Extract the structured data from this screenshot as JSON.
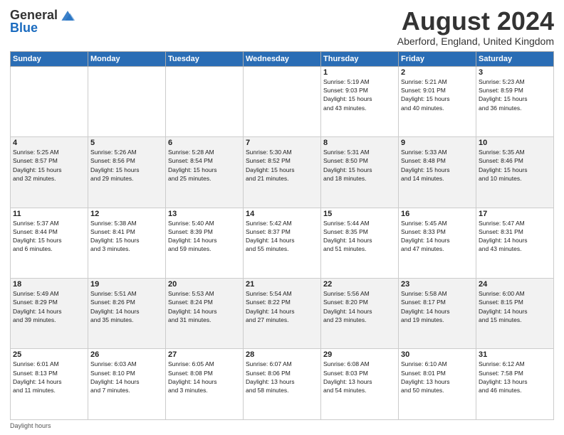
{
  "logo": {
    "general": "General",
    "blue": "Blue"
  },
  "header": {
    "month_year": "August 2024",
    "location": "Aberford, England, United Kingdom"
  },
  "days_of_week": [
    "Sunday",
    "Monday",
    "Tuesday",
    "Wednesday",
    "Thursday",
    "Friday",
    "Saturday"
  ],
  "weeks": [
    [
      {
        "day": "",
        "info": ""
      },
      {
        "day": "",
        "info": ""
      },
      {
        "day": "",
        "info": ""
      },
      {
        "day": "",
        "info": ""
      },
      {
        "day": "1",
        "info": "Sunrise: 5:19 AM\nSunset: 9:03 PM\nDaylight: 15 hours\nand 43 minutes."
      },
      {
        "day": "2",
        "info": "Sunrise: 5:21 AM\nSunset: 9:01 PM\nDaylight: 15 hours\nand 40 minutes."
      },
      {
        "day": "3",
        "info": "Sunrise: 5:23 AM\nSunset: 8:59 PM\nDaylight: 15 hours\nand 36 minutes."
      }
    ],
    [
      {
        "day": "4",
        "info": "Sunrise: 5:25 AM\nSunset: 8:57 PM\nDaylight: 15 hours\nand 32 minutes."
      },
      {
        "day": "5",
        "info": "Sunrise: 5:26 AM\nSunset: 8:56 PM\nDaylight: 15 hours\nand 29 minutes."
      },
      {
        "day": "6",
        "info": "Sunrise: 5:28 AM\nSunset: 8:54 PM\nDaylight: 15 hours\nand 25 minutes."
      },
      {
        "day": "7",
        "info": "Sunrise: 5:30 AM\nSunset: 8:52 PM\nDaylight: 15 hours\nand 21 minutes."
      },
      {
        "day": "8",
        "info": "Sunrise: 5:31 AM\nSunset: 8:50 PM\nDaylight: 15 hours\nand 18 minutes."
      },
      {
        "day": "9",
        "info": "Sunrise: 5:33 AM\nSunset: 8:48 PM\nDaylight: 15 hours\nand 14 minutes."
      },
      {
        "day": "10",
        "info": "Sunrise: 5:35 AM\nSunset: 8:46 PM\nDaylight: 15 hours\nand 10 minutes."
      }
    ],
    [
      {
        "day": "11",
        "info": "Sunrise: 5:37 AM\nSunset: 8:44 PM\nDaylight: 15 hours\nand 6 minutes."
      },
      {
        "day": "12",
        "info": "Sunrise: 5:38 AM\nSunset: 8:41 PM\nDaylight: 15 hours\nand 3 minutes."
      },
      {
        "day": "13",
        "info": "Sunrise: 5:40 AM\nSunset: 8:39 PM\nDaylight: 14 hours\nand 59 minutes."
      },
      {
        "day": "14",
        "info": "Sunrise: 5:42 AM\nSunset: 8:37 PM\nDaylight: 14 hours\nand 55 minutes."
      },
      {
        "day": "15",
        "info": "Sunrise: 5:44 AM\nSunset: 8:35 PM\nDaylight: 14 hours\nand 51 minutes."
      },
      {
        "day": "16",
        "info": "Sunrise: 5:45 AM\nSunset: 8:33 PM\nDaylight: 14 hours\nand 47 minutes."
      },
      {
        "day": "17",
        "info": "Sunrise: 5:47 AM\nSunset: 8:31 PM\nDaylight: 14 hours\nand 43 minutes."
      }
    ],
    [
      {
        "day": "18",
        "info": "Sunrise: 5:49 AM\nSunset: 8:29 PM\nDaylight: 14 hours\nand 39 minutes."
      },
      {
        "day": "19",
        "info": "Sunrise: 5:51 AM\nSunset: 8:26 PM\nDaylight: 14 hours\nand 35 minutes."
      },
      {
        "day": "20",
        "info": "Sunrise: 5:53 AM\nSunset: 8:24 PM\nDaylight: 14 hours\nand 31 minutes."
      },
      {
        "day": "21",
        "info": "Sunrise: 5:54 AM\nSunset: 8:22 PM\nDaylight: 14 hours\nand 27 minutes."
      },
      {
        "day": "22",
        "info": "Sunrise: 5:56 AM\nSunset: 8:20 PM\nDaylight: 14 hours\nand 23 minutes."
      },
      {
        "day": "23",
        "info": "Sunrise: 5:58 AM\nSunset: 8:17 PM\nDaylight: 14 hours\nand 19 minutes."
      },
      {
        "day": "24",
        "info": "Sunrise: 6:00 AM\nSunset: 8:15 PM\nDaylight: 14 hours\nand 15 minutes."
      }
    ],
    [
      {
        "day": "25",
        "info": "Sunrise: 6:01 AM\nSunset: 8:13 PM\nDaylight: 14 hours\nand 11 minutes."
      },
      {
        "day": "26",
        "info": "Sunrise: 6:03 AM\nSunset: 8:10 PM\nDaylight: 14 hours\nand 7 minutes."
      },
      {
        "day": "27",
        "info": "Sunrise: 6:05 AM\nSunset: 8:08 PM\nDaylight: 14 hours\nand 3 minutes."
      },
      {
        "day": "28",
        "info": "Sunrise: 6:07 AM\nSunset: 8:06 PM\nDaylight: 13 hours\nand 58 minutes."
      },
      {
        "day": "29",
        "info": "Sunrise: 6:08 AM\nSunset: 8:03 PM\nDaylight: 13 hours\nand 54 minutes."
      },
      {
        "day": "30",
        "info": "Sunrise: 6:10 AM\nSunset: 8:01 PM\nDaylight: 13 hours\nand 50 minutes."
      },
      {
        "day": "31",
        "info": "Sunrise: 6:12 AM\nSunset: 7:58 PM\nDaylight: 13 hours\nand 46 minutes."
      }
    ]
  ],
  "footer": {
    "daylight_label": "Daylight hours"
  }
}
